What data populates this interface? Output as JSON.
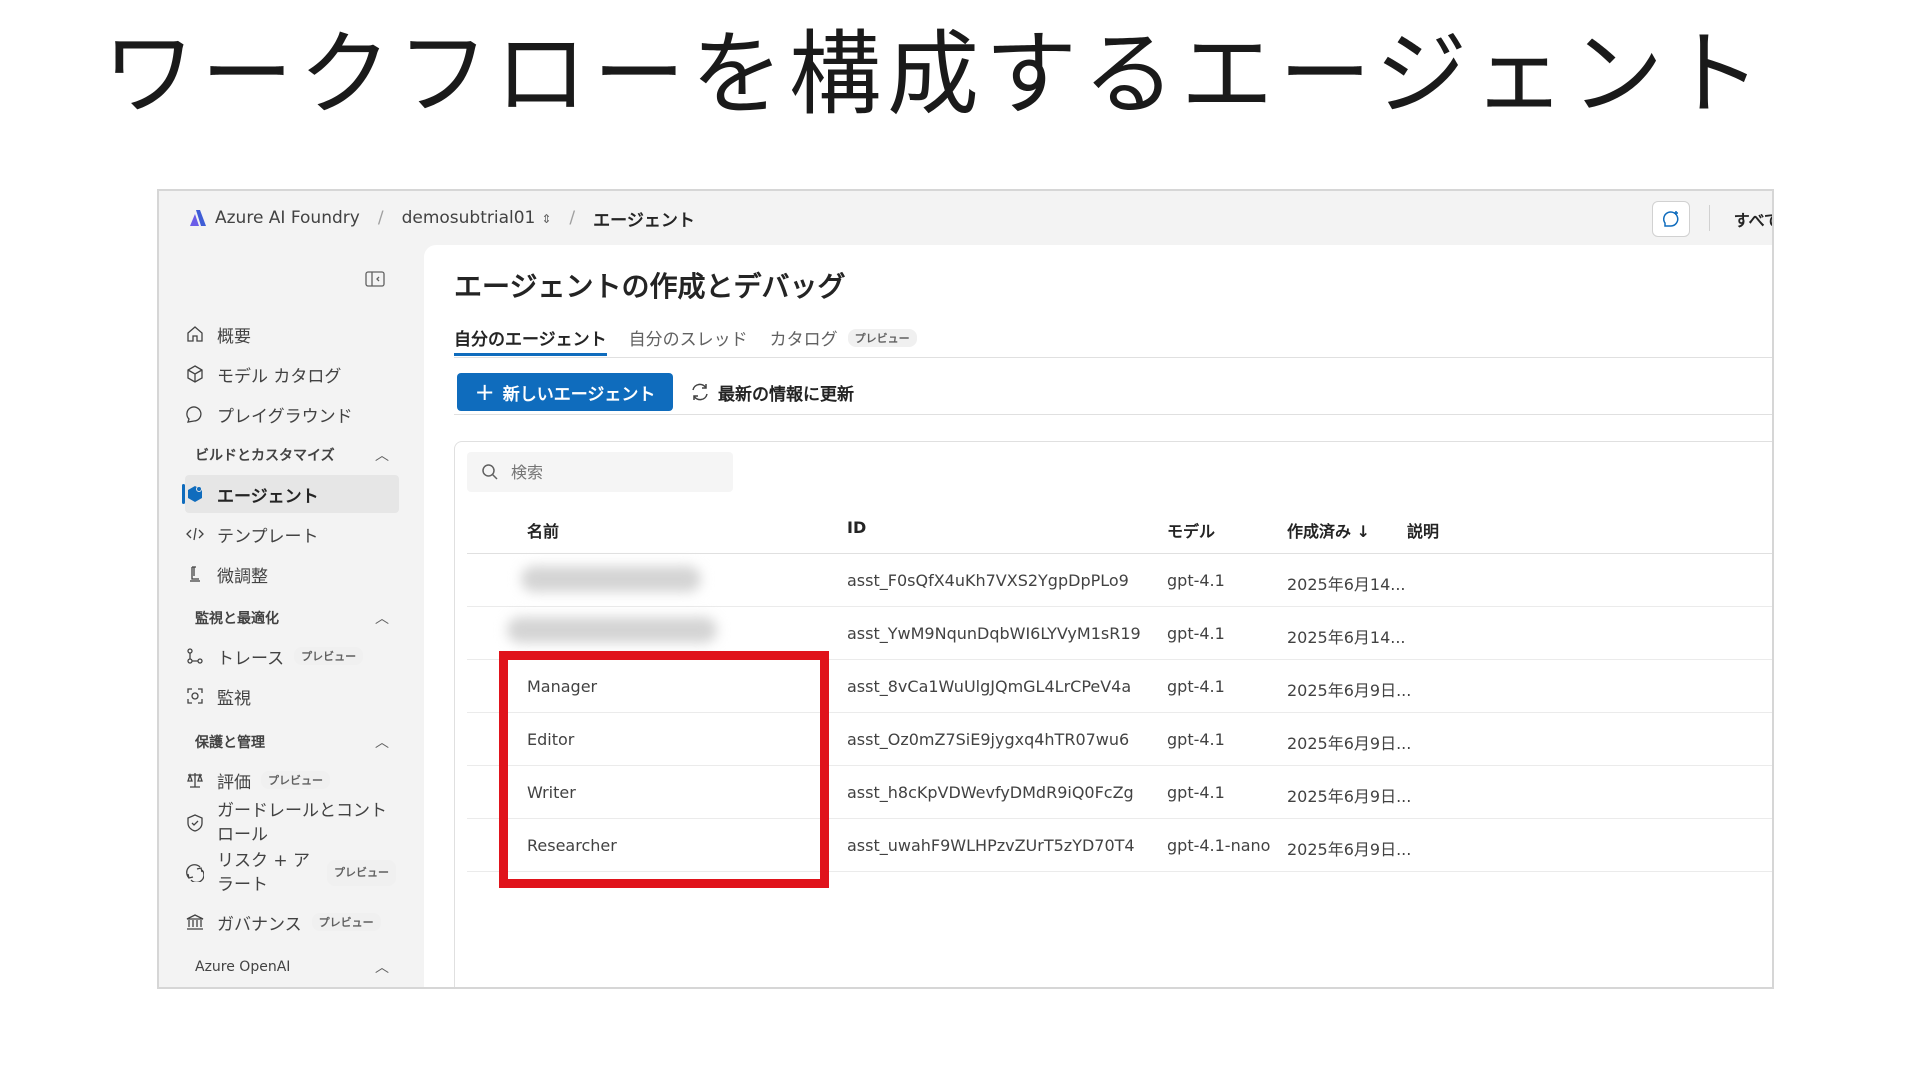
{
  "slide": {
    "title": "ワークフローを構成するエージェント"
  },
  "topbar": {
    "brand": "Azure AI Foundry",
    "project": "demosubtrial01",
    "page": "エージェント",
    "all_label": "すべて"
  },
  "sidebar": {
    "items_top": [
      {
        "label": "概要",
        "icon": "home-icon"
      },
      {
        "label": "モデル カタログ",
        "icon": "cube-icon"
      },
      {
        "label": "プレイグラウンド",
        "icon": "chat-icon"
      }
    ],
    "section_build": "ビルドとカスタマイズ",
    "items_build": [
      {
        "label": "エージェント",
        "icon": "agent-icon"
      },
      {
        "label": "テンプレート",
        "icon": "code-icon"
      },
      {
        "label": "微調整",
        "icon": "flask-icon"
      }
    ],
    "section_monitor": "監視と最適化",
    "items_monitor": [
      {
        "label": "トレース",
        "icon": "trace-icon",
        "badge": "プレビュー"
      },
      {
        "label": "監視",
        "icon": "monitor-icon"
      }
    ],
    "section_protect": "保護と管理",
    "items_protect": [
      {
        "label": "評価",
        "icon": "scale-icon",
        "badge": "プレビュー"
      },
      {
        "label_line1": "ガードレールとコント",
        "label_line2": "ロール",
        "icon": "shield-icon"
      },
      {
        "label_line1": "リスク + ア",
        "label_line2": "ラート",
        "icon": "risk-icon",
        "badge": "プレビュー"
      },
      {
        "label": "ガバナンス",
        "icon": "bank-icon",
        "badge": "プレビュー"
      }
    ],
    "section_openai": "Azure OpenAI"
  },
  "main": {
    "title": "エージェントの作成とデバッグ",
    "tabs": [
      {
        "label": "自分のエージェント"
      },
      {
        "label": "自分のスレッド"
      },
      {
        "label": "カタログ",
        "badge": "プレビュー"
      }
    ],
    "new_agent_label": "新しいエージェント",
    "refresh_label": "最新の情報に更新",
    "search_placeholder": "検索"
  },
  "table": {
    "columns": [
      "名前",
      "ID",
      "モデル",
      "作成済み ↓",
      "説明"
    ],
    "rows": [
      {
        "name": "",
        "id": "asst_F0sQfX4uKh7VXS2YgpDpPLo9",
        "model": "gpt-4.1",
        "created": "2025年6月14..."
      },
      {
        "name": "",
        "id": "asst_YwM9NqunDqbWI6LYVyM1sR19",
        "model": "gpt-4.1",
        "created": "2025年6月14..."
      },
      {
        "name": "Manager",
        "id": "asst_8vCa1WuUlgJQmGL4LrCPeV4a",
        "model": "gpt-4.1",
        "created": "2025年6月9日..."
      },
      {
        "name": "Editor",
        "id": "asst_Oz0mZ7SiE9jygxq4hTR07wu6",
        "model": "gpt-4.1",
        "created": "2025年6月9日..."
      },
      {
        "name": "Writer",
        "id": "asst_h8cKpVDWevfyDMdR9iQ0FcZg",
        "model": "gpt-4.1",
        "created": "2025年6月9日..."
      },
      {
        "name": "Researcher",
        "id": "asst_uwahF9WLHPzvZUrT5zYD70T4",
        "model": "gpt-4.1-nano",
        "created": "2025年6月9日..."
      }
    ]
  },
  "colors": {
    "accent": "#0f6cbd",
    "highlight": "#e0131b"
  }
}
